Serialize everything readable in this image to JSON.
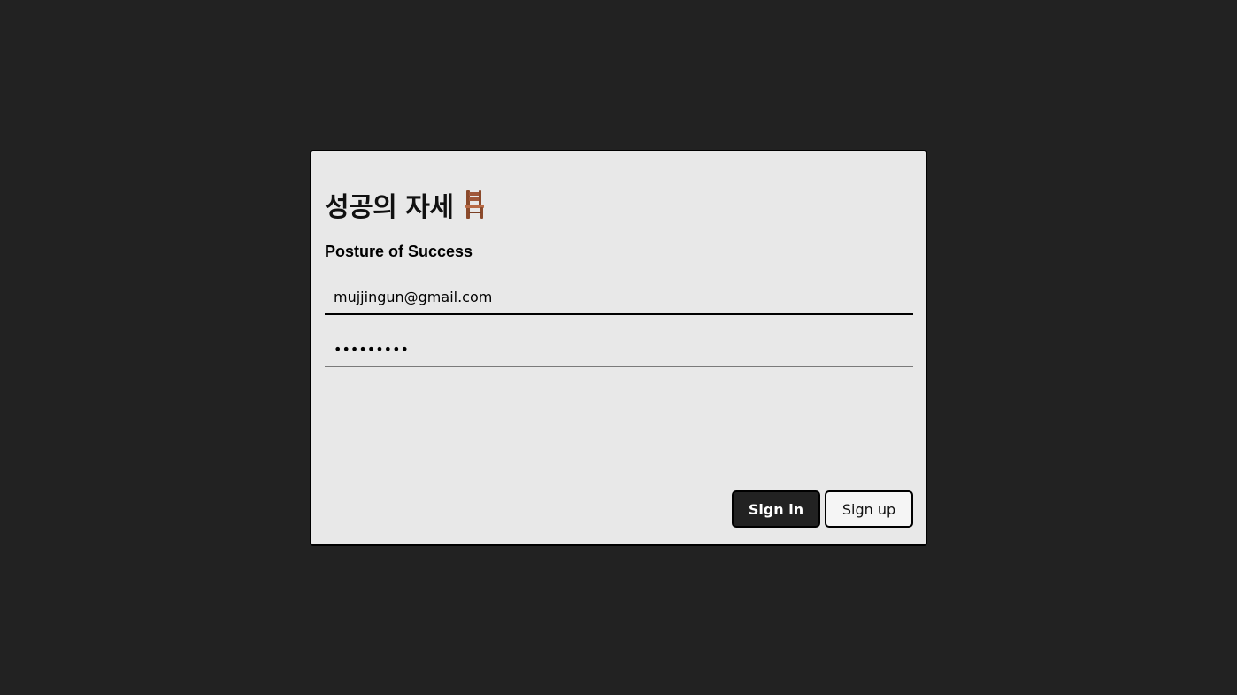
{
  "app": {
    "title": "성공의 자세",
    "title_icon": "chair-icon",
    "subtitle": "Posture of Success"
  },
  "form": {
    "email_value": "mujjingun@gmail.com",
    "password_value": "•••••••••"
  },
  "actions": {
    "signin_label": "Sign in",
    "signup_label": "Sign up"
  },
  "colors": {
    "background": "#222222",
    "card": "#e8e8e8",
    "primary_button": "#222222"
  }
}
